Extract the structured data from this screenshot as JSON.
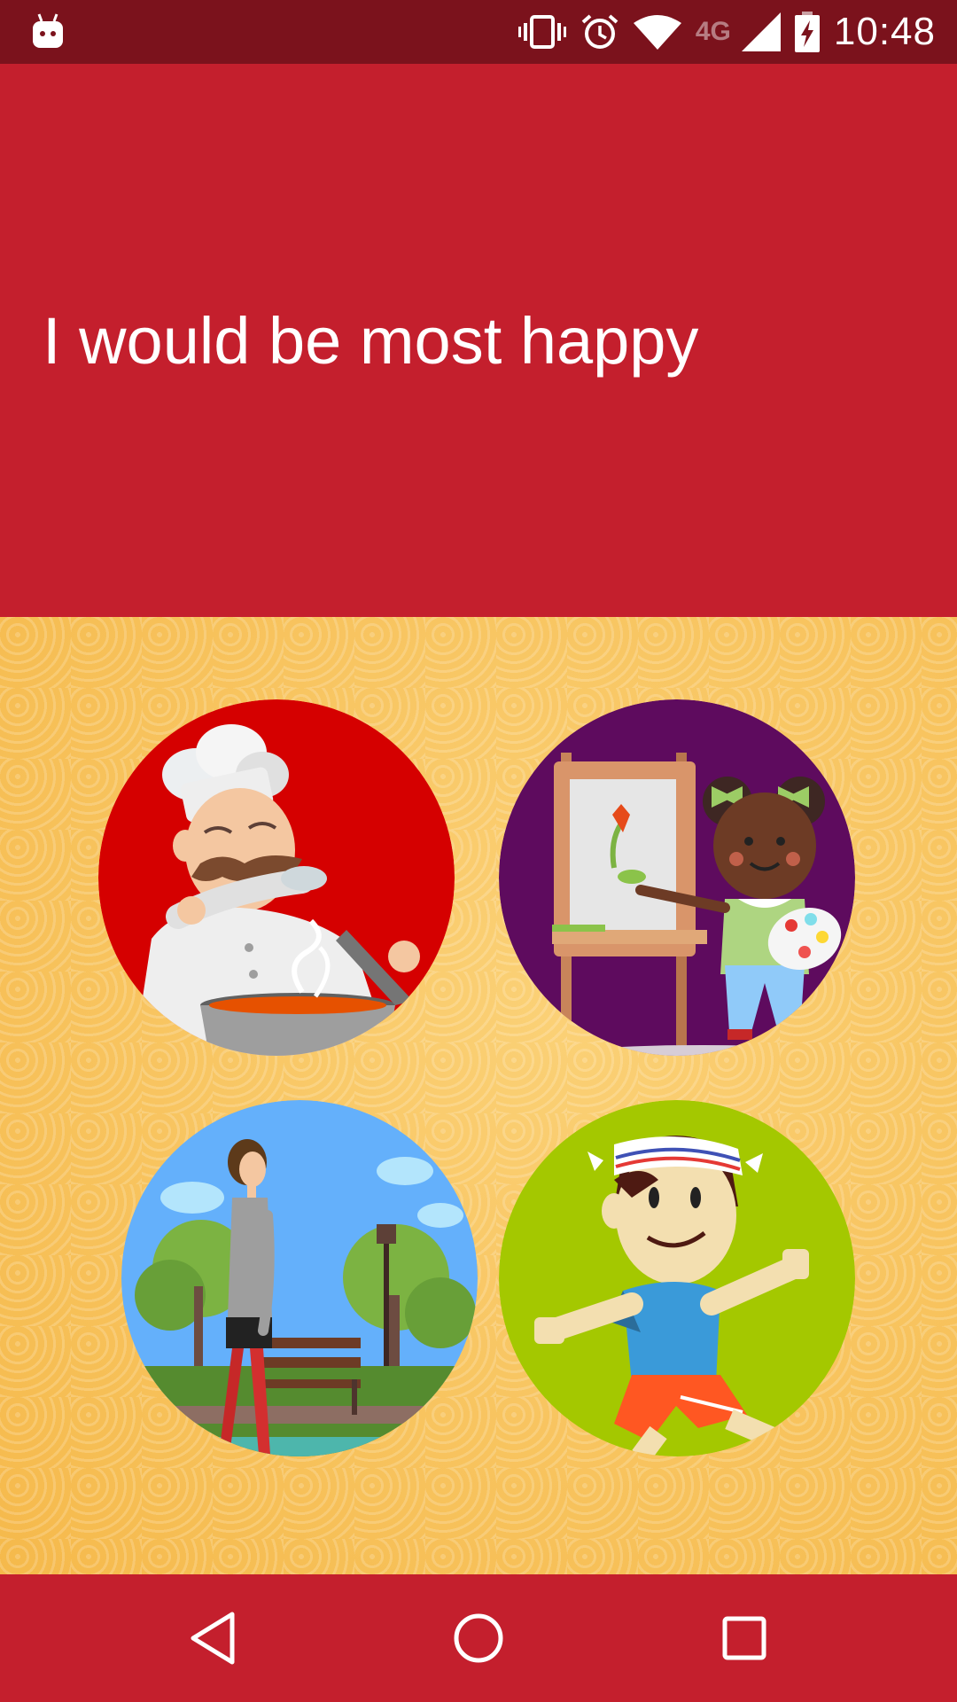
{
  "status_bar": {
    "network_label": "4G",
    "time": "10:48",
    "icons": [
      "android-notification-icon",
      "vibrate-icon",
      "alarm-icon",
      "wifi-icon",
      "signal-icon",
      "battery-charging-icon"
    ]
  },
  "header": {
    "title": "I would be most happy",
    "color": "#c41f2d"
  },
  "options": [
    {
      "name": "cooking-option",
      "icon": "chef-cooking-illustration",
      "bg": "#d50000"
    },
    {
      "name": "painting-option",
      "icon": "girl-painting-illustration",
      "bg": "#5e0b5e"
    },
    {
      "name": "walking-option",
      "icon": "woman-walking-park-illustration",
      "bg": "#64b0fb"
    },
    {
      "name": "running-option",
      "icon": "boy-running-illustration",
      "bg": "#a4c800"
    }
  ],
  "nav_bar": {
    "icons": [
      "back-icon",
      "home-icon",
      "recent-apps-icon"
    ]
  }
}
